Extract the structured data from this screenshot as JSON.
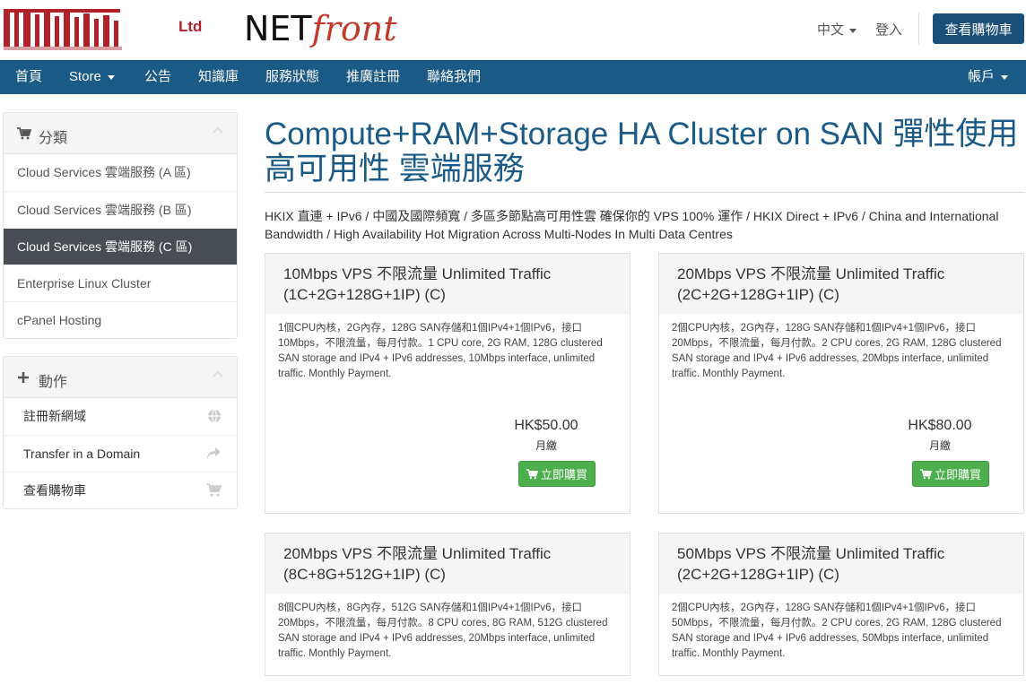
{
  "header": {
    "logo_ltd": "Ltd",
    "logo_net": "NET",
    "logo_front": "front",
    "language": "中文",
    "login": "登入",
    "view_cart": "查看購物車"
  },
  "nav": {
    "items": [
      "首頁",
      "Store",
      "公告",
      "知識庫",
      "服務狀態",
      "推廣註冊",
      "聯絡我們"
    ],
    "account": "帳戶"
  },
  "sidebar": {
    "categories_title": "分類",
    "categories": [
      "Cloud Services 雲端服務 (A 區)",
      "Cloud Services 雲端服務 (B 區)",
      "Cloud Services 雲端服務 (C 區)",
      "Enterprise Linux Cluster",
      "cPanel Hosting"
    ],
    "actions_title": "動作",
    "actions": [
      {
        "label": "註冊新網域",
        "icon": "globe-icon"
      },
      {
        "label": "Transfer in a Domain",
        "icon": "share-arrow-icon"
      },
      {
        "label": "查看購物車",
        "icon": "cart-icon"
      }
    ]
  },
  "main": {
    "title": "Compute+RAM+Storage HA Cluster on SAN 彈性使用 高可用性 雲端服務",
    "description": "HKIX 直連 + IPv6 / 中國及國際頻寬 / 多區多節點高可用性雲 確保你的 VPS 100% 運作 / HKIX Direct + IPv6 / China and International Bandwidth / High Availability Hot Migration Across Multi-Nodes In Multi Data Centres",
    "buy_label": "立即購買",
    "products": [
      {
        "name": "10Mbps VPS 不限流量 Unlimited Traffic (1C+2G+128G+1IP) (C)",
        "desc": "1個CPU內核，2G內存，128G SAN存儲和1個IPv4+1個IPv6，接口10Mbps，不限流量，每月付款。1 CPU core, 2G RAM, 128G clustered SAN storage and IPv4 + IPv6 addresses, 10Mbps interface, unlimited traffic. Monthly Payment.",
        "price": "HK$50.00",
        "cycle": "月繳"
      },
      {
        "name": "20Mbps VPS 不限流量 Unlimited Traffic (2C+2G+128G+1IP) (C)",
        "desc": "2個CPU內核，2G內存，128G SAN存儲和1個IPv4+1個IPv6，接口20Mbps，不限流量，每月付款。2 CPU cores, 2G RAM, 128G clustered SAN storage and IPv4 + IPv6 addresses, 20Mbps interface, unlimited traffic. Monthly Payment.",
        "price": "HK$80.00",
        "cycle": "月繳"
      },
      {
        "name": "20Mbps VPS 不限流量 Unlimited Traffic (8C+8G+512G+1IP) (C)",
        "desc": "8個CPU內核，8G內存，512G SAN存儲和1個IPv4+1個IPv6，接口20Mbps，不限流量，每月付款。8 CPU cores, 8G RAM, 512G clustered SAN storage and IPv4 + IPv6 addresses, 20Mbps interface, unlimited traffic. Monthly Payment.",
        "price": "",
        "cycle": ""
      },
      {
        "name": "50Mbps VPS 不限流量 Unlimited Traffic (2C+2G+128G+1IP) (C)",
        "desc": "2個CPU內核，2G內存，128G SAN存儲和1個IPv4+1個IPv6，接口50Mbps，不限流量，每月付款。2 CPU cores, 2G RAM, 128G clustered SAN storage and IPv4 + IPv6 addresses, 50Mbps interface, unlimited traffic. Monthly Payment.",
        "price": "",
        "cycle": ""
      }
    ]
  },
  "colors": {
    "navbar": "#1a5a86",
    "title": "#1a5a86",
    "buy_button": "#4cae4c",
    "active_category": "#474d52",
    "logo_red": "#b0222a"
  }
}
